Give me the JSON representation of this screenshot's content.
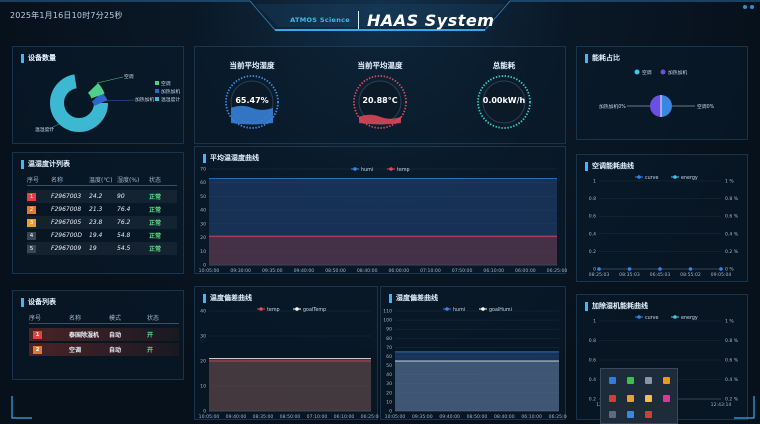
{
  "header": {
    "timestamp": "2025年1月16日10时7分25秒",
    "logo": "ATMOS Science",
    "title": "HAAS System"
  },
  "device_count": {
    "title": "设备数量",
    "legend": [
      "空调",
      "加热加机",
      "温湿度计"
    ],
    "labels": [
      "空调",
      "加热加机",
      "温湿度计"
    ],
    "colors": [
      "#4fd08a",
      "#2e66c8",
      "#3cb8d2"
    ]
  },
  "thermo_list": {
    "title": "温湿度计列表",
    "columns": [
      "序号",
      "名称",
      "温度(℃)",
      "湿度(%)",
      "状态"
    ],
    "rows": [
      {
        "idx": "1",
        "name": "F2967003",
        "temp": "24.2",
        "humi": "90",
        "status": "正常",
        "color": "#e0433f"
      },
      {
        "idx": "2",
        "name": "F2967008",
        "temp": "21.3",
        "humi": "76.4",
        "status": "正常",
        "color": "#e0782f"
      },
      {
        "idx": "3",
        "name": "F2967005",
        "temp": "23.8",
        "humi": "76.2",
        "status": "正常",
        "color": "#e6a41f"
      },
      {
        "idx": "4",
        "name": "F296700D",
        "temp": "19.4",
        "humi": "54.8",
        "status": "正常",
        "color": "#3b4654"
      },
      {
        "idx": "5",
        "name": "F2967009",
        "temp": "19",
        "humi": "54.5",
        "status": "正常",
        "color": "#3b4654"
      }
    ]
  },
  "device_list": {
    "title": "设备列表",
    "columns": [
      "序号",
      "名称",
      "模式",
      "状态"
    ],
    "rows": [
      {
        "idx": "1",
        "name": "泰国除湿机",
        "mode": "自动",
        "status": "开",
        "color": "#e0433f"
      },
      {
        "idx": "2",
        "name": "空调",
        "mode": "自动",
        "status": "开",
        "color": "#e0782f"
      }
    ]
  },
  "gauges": [
    {
      "title": "当前平均湿度",
      "value": "65.47%",
      "color": "#3a86e0",
      "ring": "#3a8fe8",
      "level": 0.6547
    },
    {
      "title": "当前平均温度",
      "value": "20.88°C",
      "color": "#e04a5a",
      "ring": "#e04a5a",
      "level": 0.2
    },
    {
      "title": "总能耗",
      "value": "0.00kW/h",
      "color": "#2fd4c4",
      "ring": "#2fd4c4",
      "level": 0
    }
  ],
  "avg_chart": {
    "title": "平均温湿度曲线",
    "legend": [
      "humi",
      "temp"
    ],
    "yticks": [
      "70",
      "60",
      "50",
      "40",
      "30",
      "20",
      "10",
      "0"
    ],
    "xticks": [
      "10:05:00",
      "09:30:00",
      "09:35:00",
      "09:40:00",
      "08:50:00",
      "08:40:00",
      "06:00:00",
      "07:10:00",
      "07:50:00",
      "06:10:00",
      "06:00:00",
      "06:25:00"
    ]
  },
  "temp_dev": {
    "title": "温度偏差曲线",
    "legend": [
      "temp",
      "goalTemp"
    ],
    "yticks": [
      "40",
      "30",
      "20",
      "10",
      "0"
    ],
    "xticks": [
      "10:05:00",
      "09:40:00",
      "08:35:00",
      "08:50:00",
      "07:10:00",
      "06:10:00",
      "06:25:00"
    ]
  },
  "humi_dev": {
    "title": "湿度偏差曲线",
    "legend": [
      "humi",
      "goalHumi"
    ],
    "yticks": [
      "110",
      "100",
      "90",
      "80",
      "70",
      "60",
      "50",
      "40",
      "30",
      "20",
      "10",
      "0"
    ],
    "xticks": [
      "10:05:00",
      "09:35:00",
      "09:40:00",
      "08:50:00",
      "08:40:00",
      "06:10:00",
      "06:25:00"
    ]
  },
  "energy_share": {
    "title": "能耗占比",
    "legend": [
      "空调",
      "加热加机"
    ],
    "left_label": "加热加机0%",
    "right_label": "空调0%"
  },
  "ac_energy": {
    "title": "空调能耗曲线",
    "legend": [
      "curve",
      "energy"
    ],
    "yticks_left": [
      "1",
      "0.8",
      "0.6",
      "0.4",
      "0.2",
      "0"
    ],
    "yticks_right": [
      "1 %",
      "0.8 %",
      "0.6 %",
      "0.4 %",
      "0.2 %",
      "0 %"
    ],
    "xticks": [
      "08:25:03",
      "08:35:03",
      "06:45:03",
      "08:55:02",
      "09:05:04"
    ]
  },
  "dehum_energy": {
    "title": "加除湿机能耗曲线",
    "legend": [
      "curve",
      "energy"
    ],
    "yticks_left": [
      "1",
      "0.8",
      "0.6",
      "0.4",
      "0.2"
    ],
    "yticks_right": [
      "1 %",
      "0.8 %",
      "0.6 %",
      "0.4 %",
      "0.2 %"
    ],
    "xticks": [
      "12",
      "12:43:12",
      "12:43:14"
    ]
  }
}
